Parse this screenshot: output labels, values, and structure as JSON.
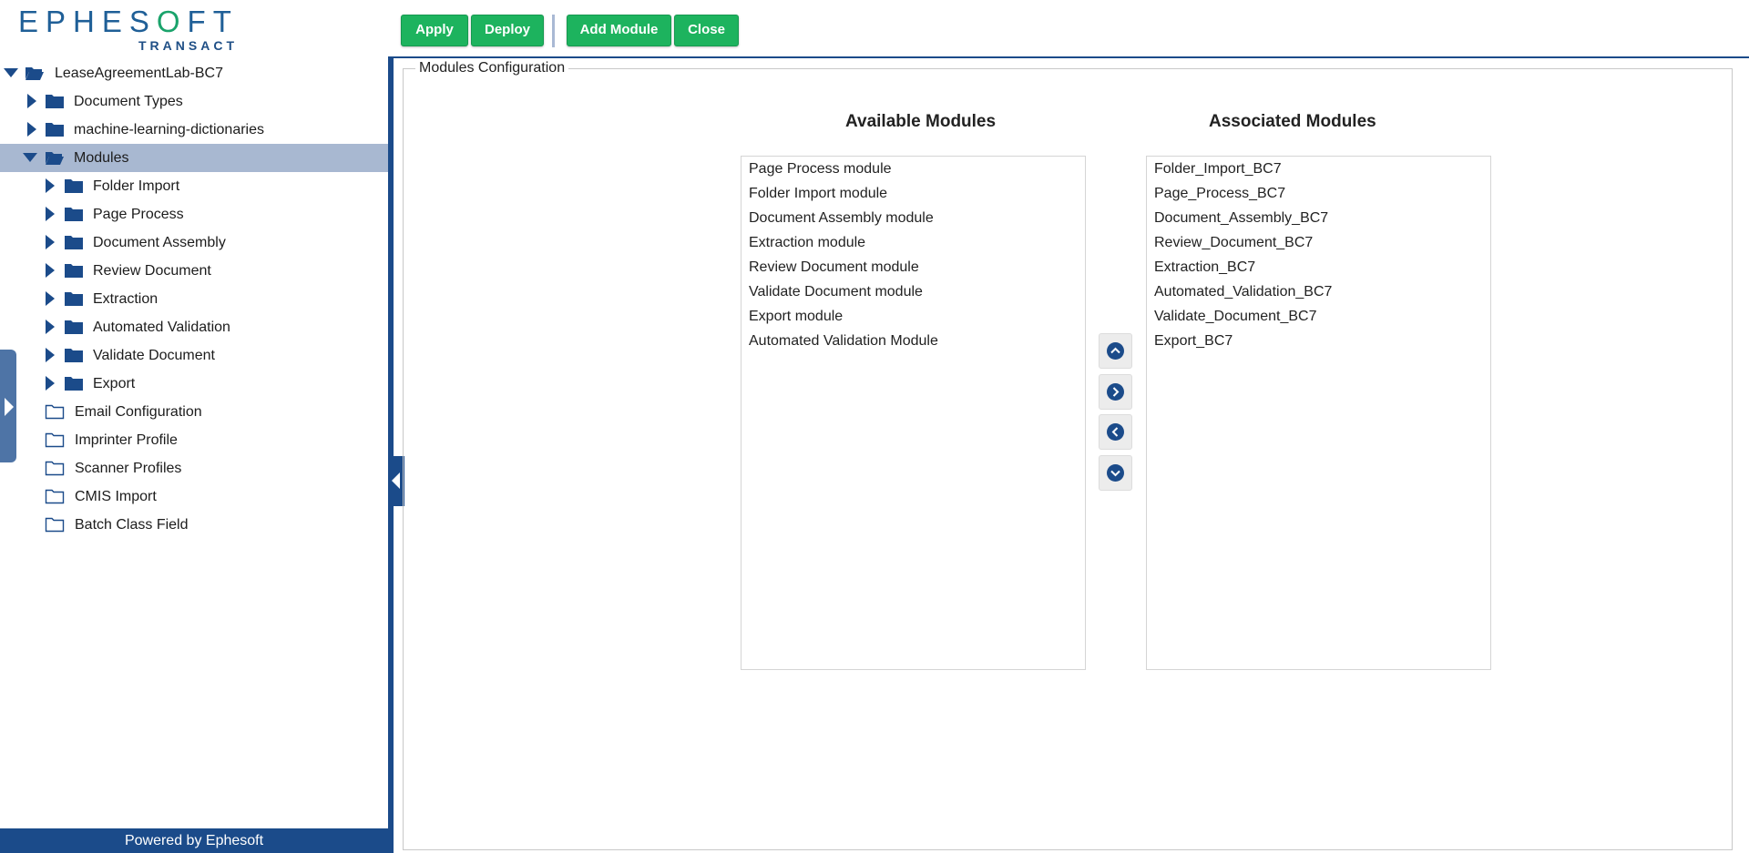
{
  "logo": {
    "top_text": "EPHESOFT",
    "bottom_text": "TRANSACT"
  },
  "toolbar": {
    "apply": "Apply",
    "deploy": "Deploy",
    "add_module": "Add Module",
    "close": "Close"
  },
  "tree": {
    "root": "LeaseAgreementLab-BC7",
    "document_types": "Document Types",
    "ml_dictionaries": "machine-learning-dictionaries",
    "modules": "Modules",
    "module_children": [
      "Folder Import",
      "Page Process",
      "Document Assembly",
      "Review Document",
      "Extraction",
      "Automated Validation",
      "Validate Document",
      "Export"
    ],
    "other_items": [
      "Email Configuration",
      "Imprinter Profile",
      "Scanner Profiles",
      "CMIS Import",
      "Batch Class Field"
    ]
  },
  "footer": "Powered by Ephesoft",
  "main": {
    "legend": "Modules Configuration",
    "available_title": "Available Modules",
    "associated_title": "Associated Modules",
    "available": [
      "Page Process module",
      "Folder Import module",
      "Document Assembly module",
      "Extraction module",
      "Review Document module",
      "Validate Document module",
      "Export module",
      "Automated Validation Module"
    ],
    "associated": [
      "Folder_Import_BC7",
      "Page_Process_BC7",
      "Document_Assembly_BC7",
      "Review_Document_BC7",
      "Extraction_BC7",
      "Automated_Validation_BC7",
      "Validate_Document_BC7",
      "Export_BC7"
    ]
  },
  "colors": {
    "brand_blue": "#1b4b8a",
    "button_green": "#1db35e",
    "selected_row": "#a8b8d1",
    "logo_accent": "#1aa36b"
  },
  "icons": {
    "move_up": "chevron-up-icon",
    "move_right": "chevron-right-icon",
    "move_left": "chevron-left-icon",
    "move_down": "chevron-down-icon"
  }
}
